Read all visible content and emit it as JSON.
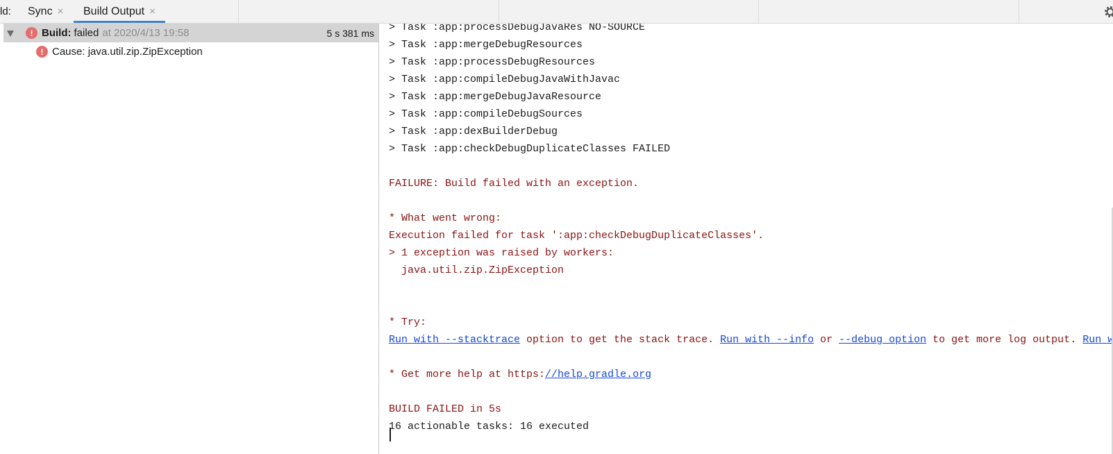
{
  "tabbar": {
    "tool_label": "ld:",
    "tabs": [
      {
        "label": "Sync",
        "close": "×"
      },
      {
        "label": "Build Output",
        "close": "×"
      }
    ]
  },
  "tree": {
    "build_row": {
      "label": "Build:",
      "status": "failed",
      "time": "at 2020/4/13 19:58",
      "duration": "5 s 381 ms"
    },
    "cause_row": {
      "text": "Cause: java.util.zip.ZipException"
    },
    "error_glyph": "!"
  },
  "console": {
    "tasks": [
      "> Task :app:processDebugJavaRes NO-SOURCE",
      "> Task :app:mergeDebugResources",
      "> Task :app:processDebugResources",
      "> Task :app:compileDebugJavaWithJavac",
      "> Task :app:mergeDebugJavaResource",
      "> Task :app:compileDebugSources",
      "> Task :app:dexBuilderDebug",
      "> Task :app:checkDebugDuplicateClasses FAILED"
    ],
    "failure": "FAILURE: Build failed with an exception.",
    "what_went_wrong": "* What went wrong:",
    "execution_failed": "Execution failed for task ':app:checkDebugDuplicateClasses'.",
    "exception_raised": "> 1 exception was raised by workers:",
    "exception_name": "  java.util.zip.ZipException",
    "try": "* Try:",
    "try_line": {
      "link1": "Run with --stacktrace",
      "text1": " option to get the stack trace. ",
      "link2": "Run with --info",
      "text2": " or ",
      "link3": "--debug option",
      "text3": " to get more log output. ",
      "link4": "Run with --scan"
    },
    "help_prefix": "* Get more help at https:",
    "help_link": "//help.gradle.org",
    "build_failed": "BUILD FAILED in 5s",
    "tasks_summary": "16 actionable tasks: 16 executed"
  },
  "colors": {
    "accent": "#4083c9",
    "error_text": "#8b1111",
    "link": "#1547d4",
    "error_icon": "#e46d6d"
  }
}
